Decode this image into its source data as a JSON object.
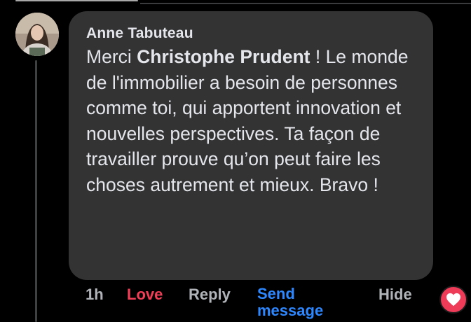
{
  "comment": {
    "author": "Anne Tabuteau",
    "text_before_mention": "Merci ",
    "mention": "Christophe Prudent",
    "text_after_mention": " ! Le monde de l'immobilier a besoin de personnes comme toi, qui apportent innovation et nouvelles perspectives. Ta façon de travailler prouve qu’on peut faire les choses autrement et mieux. Bravo !"
  },
  "actions": {
    "time": "1h",
    "love": "Love",
    "reply": "Reply",
    "send_message": "Send message",
    "hide": "Hide"
  },
  "reaction": {
    "type": "love-icon"
  },
  "colors": {
    "background": "#000000",
    "bubble": "#333334",
    "text": "#e4e6eb",
    "muted": "#b0b3b8",
    "love": "#f33e58",
    "link": "#2d88ff"
  }
}
